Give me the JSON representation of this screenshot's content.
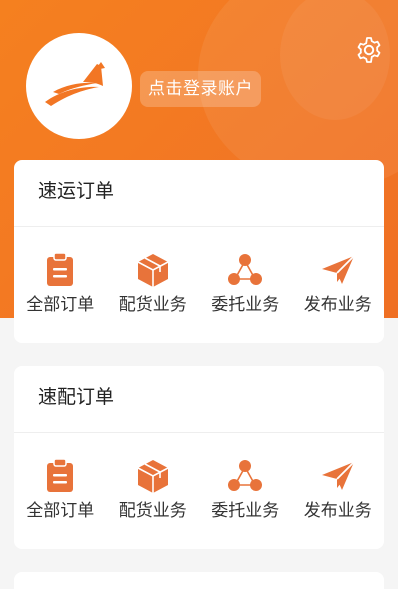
{
  "header": {
    "login_label": "点击登录账户"
  },
  "colors": {
    "brand": "#f27624",
    "icon": "#e8733a"
  },
  "sections": [
    {
      "title": "速运订单",
      "items": [
        {
          "label": "全部订单",
          "icon": "clipboard-icon"
        },
        {
          "label": "配货业务",
          "icon": "package-icon"
        },
        {
          "label": "委托业务",
          "icon": "network-icon"
        },
        {
          "label": "发布业务",
          "icon": "paper-plane-icon"
        }
      ]
    },
    {
      "title": "速配订单",
      "items": [
        {
          "label": "全部订单",
          "icon": "clipboard-icon"
        },
        {
          "label": "配货业务",
          "icon": "package-icon"
        },
        {
          "label": "委托业务",
          "icon": "network-icon"
        },
        {
          "label": "发布业务",
          "icon": "paper-plane-icon"
        }
      ]
    }
  ]
}
